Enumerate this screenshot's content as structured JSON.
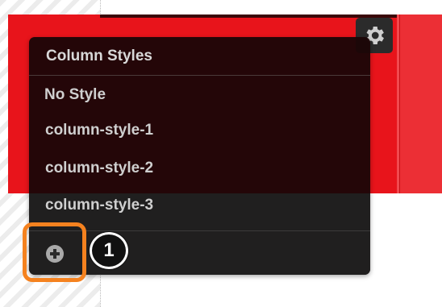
{
  "dropdown": {
    "title": "Column Styles",
    "items": [
      "No Style",
      "column-style-1",
      "column-style-2",
      "column-style-3"
    ]
  },
  "icons": {
    "settings": "gear-icon",
    "add": "plus-circle-icon"
  },
  "callout": {
    "label": "1"
  },
  "colors": {
    "column_background": "#e8141b",
    "panel_background": "#1c0607",
    "highlight": "#f5821f"
  }
}
